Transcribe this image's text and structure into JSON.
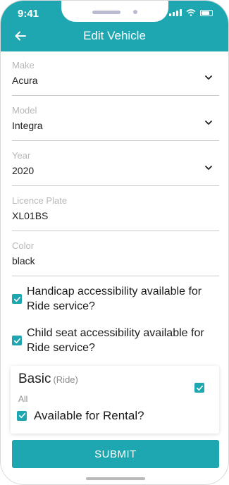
{
  "status": {
    "time": "9:41"
  },
  "header": {
    "title": "Edit Vehicle",
    "back_icon": "arrow-left-icon"
  },
  "form": {
    "make": {
      "label": "Make",
      "value": "Acura"
    },
    "model": {
      "label": "Model",
      "value": "Integra"
    },
    "year": {
      "label": "Year",
      "value": "2020"
    },
    "plate": {
      "label": "Licence Plate",
      "value": "XL01BS"
    },
    "color": {
      "label": "Color",
      "value": "black"
    }
  },
  "options": {
    "handicap": {
      "label": "Handicap accessibility available for Ride service?",
      "checked": true
    },
    "child_seat": {
      "label": "Child seat accessibility available for Ride service?",
      "checked": true
    }
  },
  "service_card": {
    "title": "Basic",
    "type": "(Ride)",
    "subtitle": "All",
    "selected": true,
    "rental_label": "Available for Rental?",
    "rental_checked": true
  },
  "submit_label": "SUBMIT",
  "colors": {
    "accent": "#1ea7b1",
    "label_gray": "#b7b7b7",
    "text": "#222222"
  }
}
